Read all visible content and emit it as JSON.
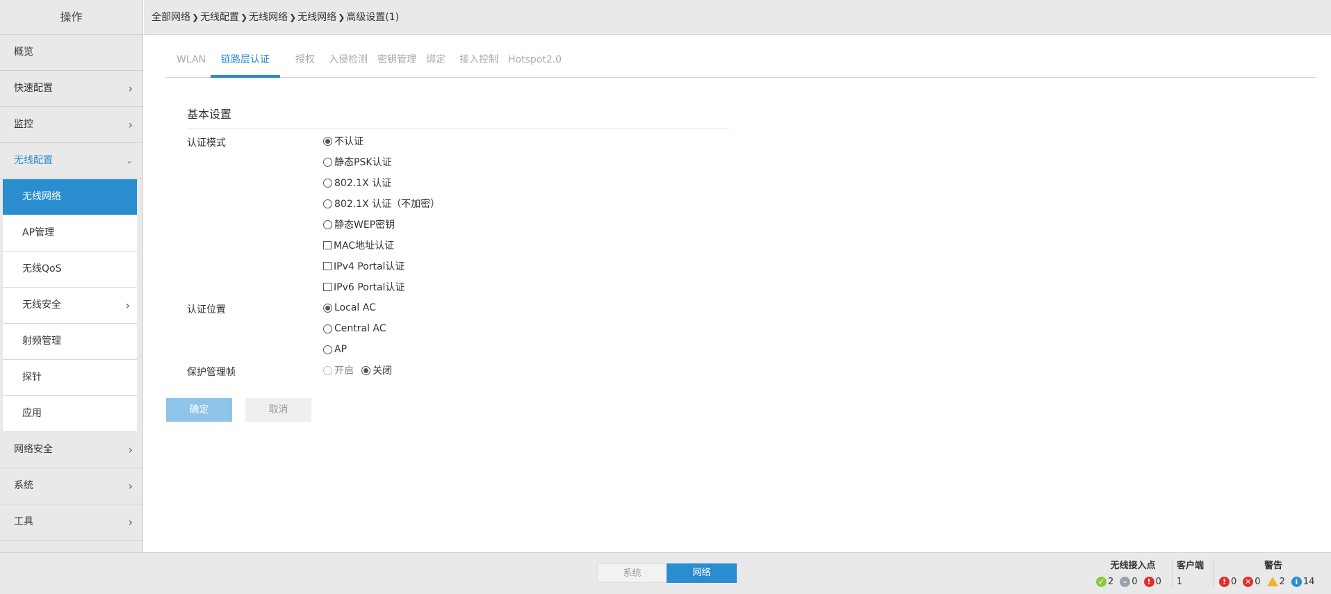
{
  "sidebar": {
    "title": "操作",
    "items": [
      {
        "label": "概览",
        "has_chevron": false
      },
      {
        "label": "快速配置",
        "has_chevron": true
      },
      {
        "label": "监控",
        "has_chevron": true
      },
      {
        "label": "无线配置",
        "has_chevron": true,
        "open": true
      },
      {
        "label": "网络安全",
        "has_chevron": true
      },
      {
        "label": "系统",
        "has_chevron": true
      },
      {
        "label": "工具",
        "has_chevron": true
      }
    ],
    "subitems": [
      {
        "label": "无线网络",
        "active": true
      },
      {
        "label": "AP管理"
      },
      {
        "label": "无线QoS"
      },
      {
        "label": "无线安全",
        "has_chevron": true
      },
      {
        "label": "射频管理"
      },
      {
        "label": "探针"
      },
      {
        "label": "应用"
      }
    ]
  },
  "breadcrumb": [
    "全部网络",
    "无线配置",
    "无线网络",
    "无线网络",
    "高级设置(1)"
  ],
  "tabs": [
    {
      "label": "WLAN"
    },
    {
      "label": "链路层认证",
      "active": true
    },
    {
      "label": "授权"
    },
    {
      "label": "入侵检测"
    },
    {
      "label": "密钥管理"
    },
    {
      "label": "绑定"
    },
    {
      "label": "接入控制"
    },
    {
      "label": "Hotspot2.0"
    }
  ],
  "form": {
    "section_title": "基本设置",
    "auth_mode": {
      "label": "认证模式",
      "radio_options": [
        {
          "label": "不认证",
          "checked": true
        },
        {
          "label": "静态PSK认证",
          "checked": false
        },
        {
          "label": "802.1X 认证",
          "checked": false
        },
        {
          "label": "802.1X 认证（不加密）",
          "checked": false
        },
        {
          "label": "静态WEP密钥",
          "checked": false
        }
      ],
      "checkbox_options": [
        {
          "label": "MAC地址认证",
          "checked": false
        },
        {
          "label": "IPv4 Portal认证",
          "checked": false
        },
        {
          "label": "IPv6 Portal认证",
          "checked": false
        }
      ]
    },
    "auth_location": {
      "label": "认证位置",
      "options": [
        {
          "label": "Local AC",
          "checked": true
        },
        {
          "label": "Central AC",
          "checked": false
        },
        {
          "label": "AP",
          "checked": false
        }
      ]
    },
    "protect_mgmt": {
      "label": "保护管理帧",
      "options": [
        {
          "label": "开启",
          "checked": false,
          "disabled": true
        },
        {
          "label": "关闭",
          "checked": true
        }
      ]
    },
    "ok_label": "确定",
    "cancel_label": "取消"
  },
  "footer": {
    "toggle": [
      {
        "label": "系统",
        "active": false
      },
      {
        "label": "网络",
        "active": true
      }
    ],
    "ap_stats": {
      "title": "无线接入点",
      "online": "2",
      "offline": "0",
      "error": "0"
    },
    "client_stats": {
      "title": "客户端",
      "count": "1"
    },
    "alarm_stats": {
      "title": "警告",
      "critical": "0",
      "major": "0",
      "minor": "2",
      "info": "14"
    },
    "colors": {
      "ok": "#8dc63f",
      "offline": "#9aa3ab",
      "error": "#e02e2e",
      "warn": "#f0b429",
      "info": "#2a8dd0"
    }
  }
}
